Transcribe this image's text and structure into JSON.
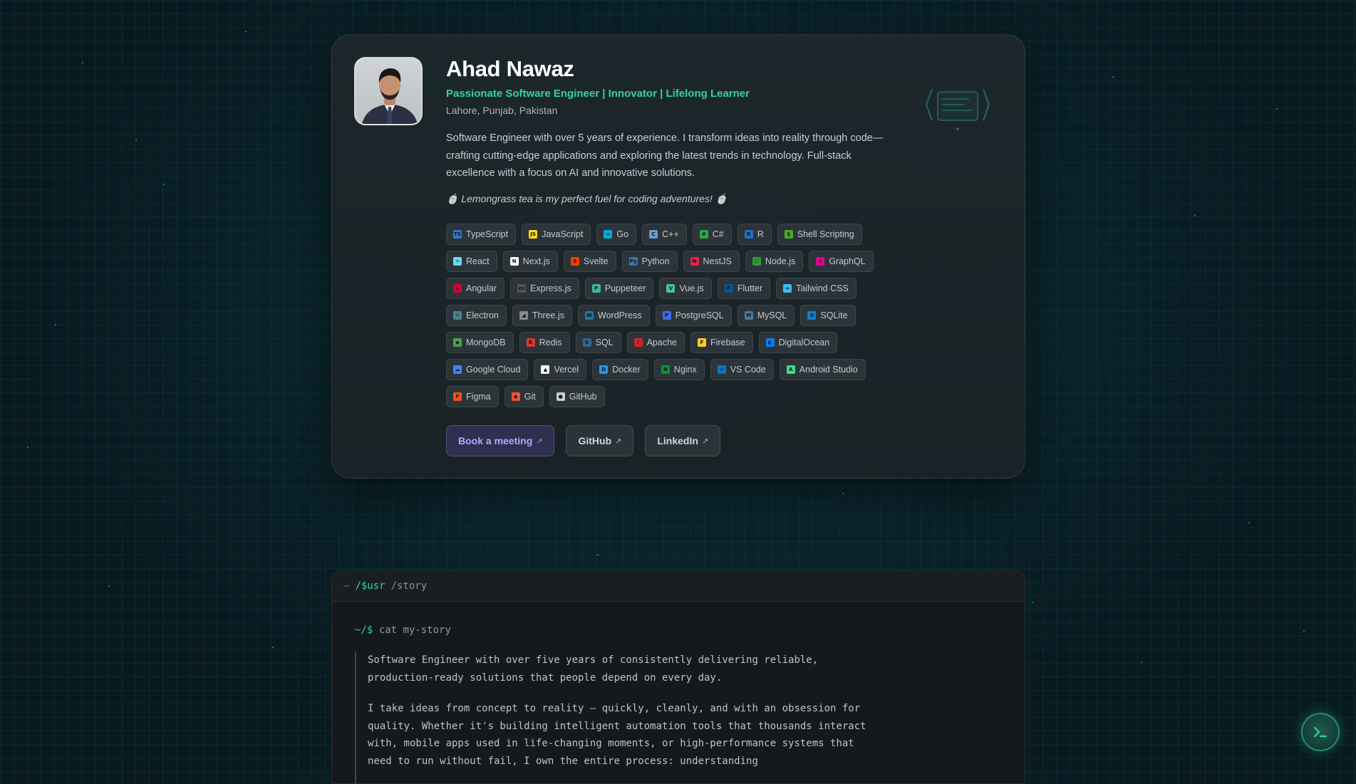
{
  "profile": {
    "name": "Ahad Nawaz",
    "tagline": "Passionate Software Engineer | Innovator | Lifelong Learner",
    "location": "Lahore, Punjab, Pakistan",
    "bio": "Software Engineer with over 5 years of experience. I transform ideas into reality through code—crafting cutting-edge applications and exploring the latest trends in technology. Full-stack excellence with a focus on AI and innovative solutions.",
    "fuel": "🍵 Lemongrass tea is my perfect fuel for coding adventures! 🍵"
  },
  "skills": [
    [
      {
        "label": "TypeScript",
        "icon": "typescript-icon",
        "color": "#3178c6",
        "glyph": "TS"
      },
      {
        "label": "JavaScript",
        "icon": "javascript-icon",
        "color": "#f7df1e",
        "glyph": "JS"
      },
      {
        "label": "Go",
        "icon": "go-icon",
        "color": "#00add8",
        "glyph": "∞"
      },
      {
        "label": "C++",
        "icon": "cpp-icon",
        "color": "#659ad2",
        "glyph": "C"
      },
      {
        "label": "C#",
        "icon": "csharp-icon",
        "color": "#2ea44f",
        "glyph": "#"
      },
      {
        "label": "R",
        "icon": "r-icon",
        "color": "#276dc3",
        "glyph": "R"
      },
      {
        "label": "Shell Scripting",
        "icon": "shell-icon",
        "color": "#4eaa25",
        "glyph": "$"
      }
    ],
    [
      {
        "label": "React",
        "icon": "react-icon",
        "color": "#61dafb",
        "glyph": "⚛"
      },
      {
        "label": "Next.js",
        "icon": "nextjs-icon",
        "color": "#ffffff",
        "glyph": "N"
      },
      {
        "label": "Svelte",
        "icon": "svelte-icon",
        "color": "#ff3e00",
        "glyph": "S"
      },
      {
        "label": "Python",
        "icon": "python-icon",
        "color": "#3776ab",
        "glyph": "Py"
      },
      {
        "label": "NestJS",
        "icon": "nestjs-icon",
        "color": "#e0234e",
        "glyph": "N"
      },
      {
        "label": "Node.js",
        "icon": "nodejs-icon",
        "color": "#339933",
        "glyph": "⬡"
      },
      {
        "label": "GraphQL",
        "icon": "graphql-icon",
        "color": "#e10098",
        "glyph": "◈"
      }
    ],
    [
      {
        "label": "Angular",
        "icon": "angular-icon",
        "color": "#dd0031",
        "glyph": "A"
      },
      {
        "label": "Express.js",
        "icon": "expressjs-icon",
        "color": "#555555",
        "glyph": "ex"
      },
      {
        "label": "Puppeteer",
        "icon": "puppeteer-icon",
        "color": "#40b5a4",
        "glyph": "P"
      },
      {
        "label": "Vue.js",
        "icon": "vuejs-icon",
        "color": "#4fc08d",
        "glyph": "V"
      },
      {
        "label": "Flutter",
        "icon": "flutter-icon",
        "color": "#02569b",
        "glyph": "F"
      },
      {
        "label": "Tailwind CSS",
        "icon": "tailwind-icon",
        "color": "#38bdf8",
        "glyph": "≈"
      }
    ],
    [
      {
        "label": "Electron",
        "icon": "electron-icon",
        "color": "#47848f",
        "glyph": "⚛"
      },
      {
        "label": "Three.js",
        "icon": "threejs-icon",
        "color": "#888888",
        "glyph": "◢"
      },
      {
        "label": "WordPress",
        "icon": "wordpress-icon",
        "color": "#21759b",
        "glyph": "W"
      },
      {
        "label": "PostgreSQL",
        "icon": "postgresql-icon",
        "color": "#4169e1",
        "glyph": "P"
      },
      {
        "label": "MySQL",
        "icon": "mysql-icon",
        "color": "#4479a1",
        "glyph": "M"
      },
      {
        "label": "SQLite",
        "icon": "sqlite-icon",
        "color": "#0f80cc",
        "glyph": "S"
      }
    ],
    [
      {
        "label": "MongoDB",
        "icon": "mongodb-icon",
        "color": "#47a248",
        "glyph": "◆"
      },
      {
        "label": "Redis",
        "icon": "redis-icon",
        "color": "#dc382d",
        "glyph": "R"
      },
      {
        "label": "SQL",
        "icon": "sql-icon",
        "color": "#336791",
        "glyph": "S"
      },
      {
        "label": "Apache",
        "icon": "apache-icon",
        "color": "#d22128",
        "glyph": "/"
      },
      {
        "label": "Firebase",
        "icon": "firebase-icon",
        "color": "#ffca28",
        "glyph": "F"
      },
      {
        "label": "DigitalOcean",
        "icon": "digitalocean-icon",
        "color": "#0080ff",
        "glyph": "◐"
      }
    ],
    [
      {
        "label": "Google Cloud",
        "icon": "googlecloud-icon",
        "color": "#4285f4",
        "glyph": "☁"
      },
      {
        "label": "Vercel",
        "icon": "vercel-icon",
        "color": "#ffffff",
        "glyph": "▲"
      },
      {
        "label": "Docker",
        "icon": "docker-icon",
        "color": "#2496ed",
        "glyph": "D"
      },
      {
        "label": "Nginx",
        "icon": "nginx-icon",
        "color": "#009639",
        "glyph": "N"
      },
      {
        "label": "VS Code",
        "icon": "vscode-icon",
        "color": "#007acc",
        "glyph": "<"
      },
      {
        "label": "Android Studio",
        "icon": "androidstudio-icon",
        "color": "#3ddc84",
        "glyph": "A"
      }
    ],
    [
      {
        "label": "Figma",
        "icon": "figma-icon",
        "color": "#f24e1e",
        "glyph": "F"
      },
      {
        "label": "Git",
        "icon": "git-icon",
        "color": "#f05032",
        "glyph": "◆"
      },
      {
        "label": "GitHub",
        "icon": "github-icon",
        "color": "#cccccc",
        "glyph": "●"
      }
    ]
  ],
  "actions": {
    "book": "Book a meeting",
    "github": "GitHub",
    "linkedin": "LinkedIn",
    "arrow": "↗"
  },
  "terminal": {
    "dash": "—",
    "path1": "/$usr",
    "path2": "/story",
    "prompt": "~/$",
    "command": "cat my-story",
    "paragraphs": [
      "Software Engineer with over five years of consistently delivering reliable, production-ready solutions that people depend on every day.",
      "I take ideas from concept to reality — quickly, cleanly, and with an obsession for quality. Whether it's building intelligent automation tools that thousands interact with, mobile apps used in life-changing moments, or high-performance systems that need to run without fail, I own the entire process: understanding"
    ]
  },
  "colors": {
    "accent": "#34d399",
    "primary_button": "#b9a7ff",
    "background": "#081a20"
  }
}
